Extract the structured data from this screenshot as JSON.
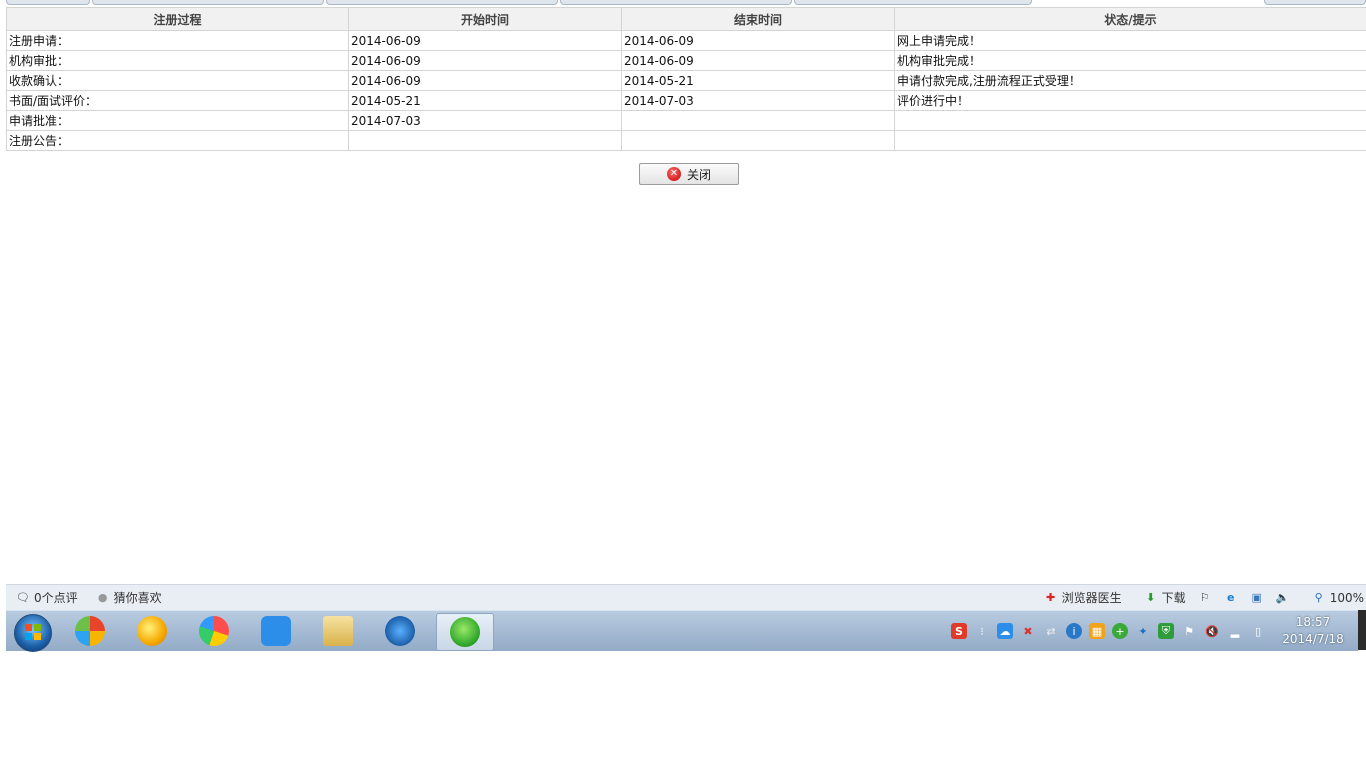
{
  "table": {
    "headers": [
      "注册过程",
      "开始时间",
      "结束时间",
      "状态/提示"
    ],
    "rows": [
      {
        "step": "注册申请：",
        "start": "2014-06-09",
        "end": "2014-06-09",
        "status": "网上申请完成！"
      },
      {
        "step": "机构审批：",
        "start": "2014-06-09",
        "end": "2014-06-09",
        "status": "机构审批完成！"
      },
      {
        "step": "收款确认：",
        "start": "2014-06-09",
        "end": "2014-05-21",
        "status": "申请付款完成,注册流程正式受理！"
      },
      {
        "step": "书面/面试评价：",
        "start": "2014-05-21",
        "end": "2014-07-03",
        "status": "评价进行中！"
      },
      {
        "step": "申请批准：",
        "start": "2014-07-03",
        "end": "",
        "status": ""
      },
      {
        "step": "注册公告：",
        "start": "",
        "end": "",
        "status": ""
      }
    ]
  },
  "close_button": {
    "label": "关闭",
    "icon": "close-circle-icon"
  },
  "statusbar": {
    "comments": "0个点评",
    "guess": "猜你喜欢",
    "doctor": "浏览器医生",
    "download": "下载",
    "zoom": "100%"
  },
  "taskbar": {
    "pinned": [
      "app-icon-1",
      "app-icon-2",
      "app-icon-3",
      "baidu-cloud-icon",
      "file-explorer-icon",
      "bird-app-icon",
      "browser-icon"
    ],
    "clock_time": "18:57",
    "clock_date": "2014/7/18"
  },
  "colors": {
    "taskbar": "#9fb6cf",
    "close_icon": "#d00000",
    "header_bg": "#f1f1f1"
  }
}
